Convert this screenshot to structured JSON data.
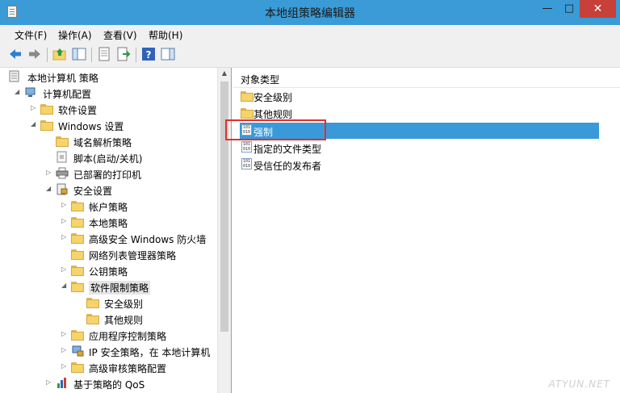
{
  "window": {
    "title": "本地组策略编辑器",
    "minimize": "—",
    "maximize": "□",
    "close": "✕"
  },
  "menu": [
    "文件(F)",
    "操作(A)",
    "查看(V)",
    "帮助(H)"
  ],
  "toolbar": [
    "back-arrow-icon",
    "forward-arrow-icon",
    "up-folder-icon",
    "show-tree-icon",
    "properties-icon",
    "export-list-icon",
    "help-icon",
    "show-action-pane-icon"
  ],
  "tree": {
    "root": "本地计算机 策略",
    "computer_config": "计算机配置",
    "software_settings": "软件设置",
    "windows_settings": "Windows 设置",
    "name_resolution": "域名解析策略",
    "scripts": "脚本(启动/关机)",
    "printers": "已部署的打印机",
    "security_settings": "安全设置",
    "account_policies": "帐户策略",
    "local_policies": "本地策略",
    "firewall": "高级安全 Windows 防火墙",
    "network_list": "网络列表管理器策略",
    "public_key": "公钥策略",
    "srp": "软件限制策略",
    "security_levels": "安全级别",
    "other_rules": "其他规则",
    "app_control": "应用程序控制策略",
    "ipsec": "IP 安全策略，在 本地计算机",
    "audit": "高级审核策略配置",
    "qos": "基于策略的 QoS"
  },
  "details": {
    "header": "对象类型",
    "items": [
      "安全级别",
      "其他规则",
      "强制",
      "指定的文件类型",
      "受信任的发布者"
    ],
    "selected_index": 2
  },
  "watermark": "ATYUN.NET"
}
